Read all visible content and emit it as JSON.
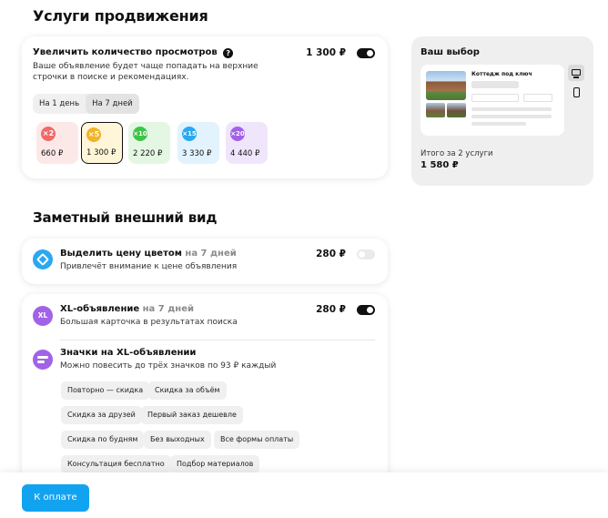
{
  "sections": {
    "promotion_title": "Услуги продвижения",
    "appearance_title": "Заметный внешний вид"
  },
  "views": {
    "title": "Увеличить количество просмотров",
    "description": "Ваше объявление будет чаще попадать на верхние строчки в поиске и рекомендациях.",
    "price": "1 300 ₽",
    "enabled": true,
    "periods": [
      "На 1 день",
      "На 7 дней"
    ],
    "selected_period": "На 7 дней",
    "options": [
      {
        "multiplier": "×2",
        "price": "660 ₽",
        "color": "#f06a6a",
        "bg": "#fde8e8"
      },
      {
        "multiplier": "×5",
        "price": "1 300 ₽",
        "color": "#f0b32a",
        "bg": "#fff6d9"
      },
      {
        "multiplier": "×10",
        "price": "2 220 ₽",
        "color": "#3fc44a",
        "bg": "#e4f7e3"
      },
      {
        "multiplier": "×15",
        "price": "3 330 ₽",
        "color": "#2aa8f0",
        "bg": "#e2f3fd"
      },
      {
        "multiplier": "×20",
        "price": "4 440 ₽",
        "color": "#a262e8",
        "bg": "#f0e6fb"
      }
    ],
    "selected_option": "×5"
  },
  "choice": {
    "title": "Ваш выбор",
    "preview_title": "Коттедж под ключ",
    "total_label": "Итого за 2 услуги",
    "total_value": "1 580 ₽"
  },
  "highlight_price": {
    "title": "Выделить цену цветом",
    "period": "на 7 дней",
    "description": "Привлечёт внимание к цене объявления",
    "price": "280 ₽",
    "enabled": false,
    "icon_color": "#2aa8f0"
  },
  "xl": {
    "icon_text": "XL",
    "title": "XL-объявление",
    "period": "на 7 дней",
    "description": "Большая карточка в результатах поиска",
    "price": "280 ₽",
    "enabled": true,
    "icon_color": "#a262e8"
  },
  "badges": {
    "title": "Значки на XL-объявлении",
    "description": "Можно повесить до трёх значков по 93 ₽ каждый",
    "icon_color": "#a262e8",
    "items": [
      "Повторно — скидка",
      "Скидка за объём",
      "Скидка за друзей",
      "Первый заказ дешевле",
      "Скидка по будням",
      "Без выходных",
      "Все формы оплаты",
      "Консультация бесплатно",
      "Подбор материалов"
    ]
  },
  "footer": {
    "pay_button": "К оплате"
  }
}
